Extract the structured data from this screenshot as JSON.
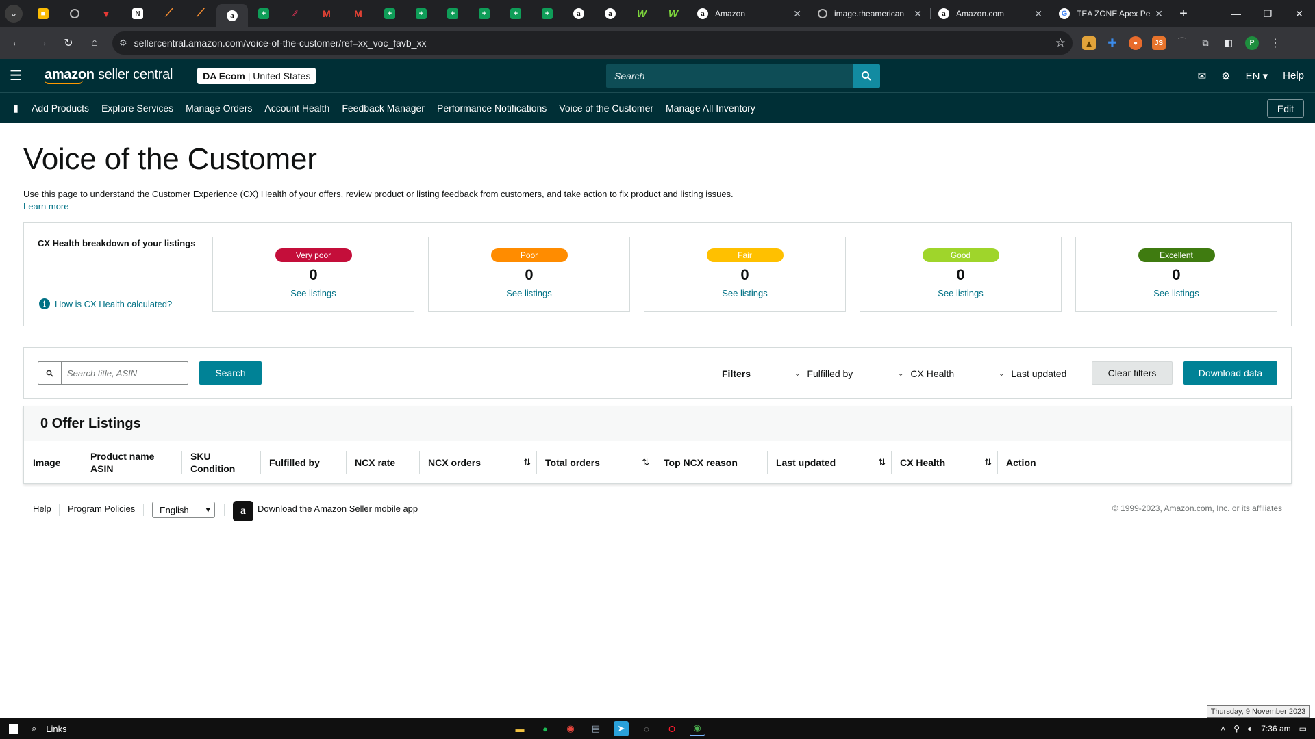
{
  "browser": {
    "mini_tabs": [
      {
        "icon": "keep-icon",
        "glyph": "■",
        "cls": "keep"
      },
      {
        "icon": "globe-icon",
        "glyph": "",
        "cls": "globe"
      },
      {
        "icon": "red-bird-icon",
        "glyph": "▼",
        "cls": "red"
      },
      {
        "icon": "notes-icon",
        "glyph": "N",
        "cls": "note"
      },
      {
        "icon": "arrow-app-icon",
        "glyph": "⟋",
        "cls": "arrow"
      },
      {
        "icon": "arrow-app-icon",
        "glyph": "⟋",
        "cls": "arrow"
      },
      {
        "icon": "amazon-icon",
        "glyph": "a",
        "cls": "amz",
        "active": true
      },
      {
        "icon": "sheets-icon",
        "glyph": "+",
        "cls": "sheet"
      },
      {
        "icon": "chart-icon",
        "glyph": "⁄⁄",
        "cls": "chart"
      },
      {
        "icon": "gmail-icon",
        "glyph": "M",
        "cls": "gm"
      },
      {
        "icon": "gmail-icon",
        "glyph": "M",
        "cls": "gm"
      },
      {
        "icon": "sheets-icon",
        "glyph": "+",
        "cls": "sheet"
      },
      {
        "icon": "sheets-icon",
        "glyph": "+",
        "cls": "sheet"
      },
      {
        "icon": "sheets-icon",
        "glyph": "+",
        "cls": "sheet"
      },
      {
        "icon": "sheets-icon",
        "glyph": "+",
        "cls": "sheet"
      },
      {
        "icon": "sheets-icon",
        "glyph": "+",
        "cls": "sheet"
      },
      {
        "icon": "sheets-icon",
        "glyph": "+",
        "cls": "sheet"
      },
      {
        "icon": "amazon-icon",
        "glyph": "a",
        "cls": "amz"
      },
      {
        "icon": "amazon-icon",
        "glyph": "a",
        "cls": "amz"
      },
      {
        "icon": "green-app-icon",
        "glyph": "W",
        "cls": "green"
      },
      {
        "icon": "green-app-icon",
        "glyph": "W",
        "cls": "green"
      }
    ],
    "wide_tabs": [
      {
        "title": "Amazon",
        "icon": "amazon-icon",
        "glyph": "a",
        "cls": "amz"
      },
      {
        "title": "image.theamerican",
        "icon": "globe-icon",
        "glyph": "",
        "cls": "globe"
      },
      {
        "title": "Amazon.com",
        "icon": "amazon-icon",
        "glyph": "a",
        "cls": "amz"
      },
      {
        "title": "TEA ZONE Apex Pe",
        "icon": "google-icon",
        "glyph": "G",
        "cls": "g"
      }
    ],
    "url": "sellercentral.amazon.com/voice-of-the-customer/ref=xx_voc_favb_xx",
    "profile_initial": "P"
  },
  "header": {
    "logo_brand": "amazon",
    "logo_product": "seller central",
    "account_name": "DA Ecom",
    "account_region": "United States",
    "search_placeholder": "Search",
    "language": "EN",
    "help": "Help"
  },
  "nav": {
    "links": [
      "Add Products",
      "Explore Services",
      "Manage Orders",
      "Account Health",
      "Feedback Manager",
      "Performance Notifications",
      "Voice of the Customer",
      "Manage All Inventory"
    ],
    "edit": "Edit"
  },
  "page": {
    "title": "Voice of the Customer",
    "description": "Use this page to understand the Customer Experience (CX) Health of your offers, review product or listing feedback from customers, and take action to fix product and listing issues.",
    "learn_more": "Learn more"
  },
  "cx_health": {
    "label": "CX Health breakdown of your listings",
    "how_link": "How is CX Health calculated?",
    "cards": [
      {
        "label": "Very poor",
        "count": "0",
        "link": "See listings",
        "color": "#c40e3a"
      },
      {
        "label": "Poor",
        "count": "0",
        "link": "See listings",
        "color": "#ff8c00"
      },
      {
        "label": "Fair",
        "count": "0",
        "link": "See listings",
        "color": "#ffc000"
      },
      {
        "label": "Good",
        "count": "0",
        "link": "See listings",
        "color": "#9fd52b"
      },
      {
        "label": "Excellent",
        "count": "0",
        "link": "See listings",
        "color": "#3f7b10"
      }
    ]
  },
  "filters": {
    "search_placeholder": "Search title, ASIN",
    "search_button": "Search",
    "filters_label": "Filters",
    "fulfilled_by": "Fulfilled by",
    "cx_health": "CX Health",
    "last_updated": "Last updated",
    "clear": "Clear filters",
    "download": "Download data"
  },
  "listings": {
    "heading": "0 Offer Listings",
    "columns": [
      {
        "line1": "Image",
        "line2": ""
      },
      {
        "line1": "Product name",
        "line2": "ASIN"
      },
      {
        "line1": "SKU",
        "line2": "Condition"
      },
      {
        "line1": "Fulfilled by",
        "line2": ""
      },
      {
        "line1": "NCX rate",
        "line2": ""
      },
      {
        "line1": "NCX orders",
        "line2": "",
        "sortable": true
      },
      {
        "line1": "Total orders",
        "line2": "",
        "sortable": true
      },
      {
        "line1": "Top NCX reason",
        "line2": ""
      },
      {
        "line1": "Last updated",
        "line2": "",
        "sortable": true
      },
      {
        "line1": "CX Health",
        "line2": "",
        "sortable": true
      },
      {
        "line1": "Action",
        "line2": ""
      }
    ]
  },
  "footer": {
    "help": "Help",
    "program_policies": "Program Policies",
    "language": "English",
    "app_text": "Download the Amazon Seller mobile app",
    "copyright": "© 1999-2023, Amazon.com, Inc. or its affiliates"
  },
  "taskbar": {
    "search_label": "Links",
    "date_tooltip": "Thursday, 9 November 2023",
    "time": "7:36 am"
  },
  "colors": {
    "header_bg": "#002f36",
    "link": "#007185",
    "button": "#008296"
  }
}
